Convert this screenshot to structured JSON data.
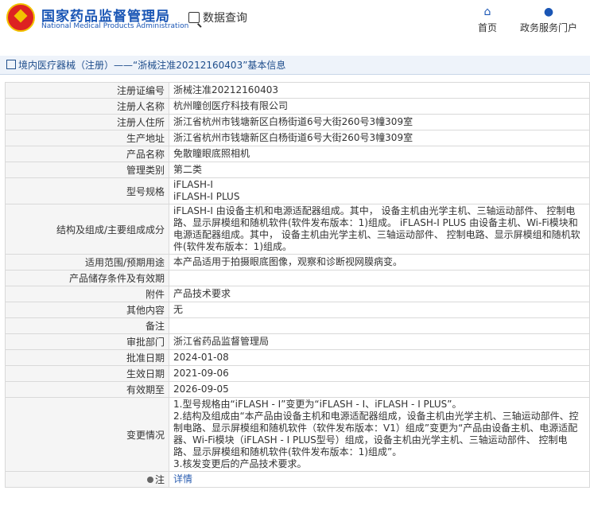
{
  "header": {
    "brand_cn": "国家药品监督管理局",
    "brand_en": "National Medical Products Administration",
    "search_label": "数据查询",
    "nav": {
      "home": "首页",
      "services": "政务服务门户"
    }
  },
  "breadcrumb": "境内医疗器械（注册）——“浙械注准20212160403”基本信息",
  "rows": [
    {
      "k": "注册证编号",
      "v": [
        "浙械注准20212160403"
      ]
    },
    {
      "k": "注册人名称",
      "v": [
        "杭州瞳创医疗科技有限公司"
      ]
    },
    {
      "k": "注册人住所",
      "v": [
        "浙江省杭州市钱塘新区白杨街道6号大街260号3幢309室"
      ]
    },
    {
      "k": "生产地址",
      "v": [
        "浙江省杭州市钱塘新区白杨街道6号大街260号3幢309室"
      ]
    },
    {
      "k": "产品名称",
      "v": [
        "免散瞳眼底照相机"
      ]
    },
    {
      "k": "管理类别",
      "v": [
        "第二类"
      ]
    },
    {
      "k": "型号规格",
      "v": [
        "iFLASH-I",
        "iFLASH-I PLUS"
      ]
    },
    {
      "k": "结构及组成/主要组成成分",
      "v": [
        "iFLASH-I 由设备主机和电源适配器组成。其中， 设备主机由光学主机、三轴运动部件、 控制电路、显示屏模组和随机软件(软件发布版本：1)组成。 iFLASH-I PLUS 由设备主机、Wi-Fi模块和电源适配器组成。其中， 设备主机由光学主机、三轴运动部件、 控制电路、显示屏模组和随机软件(软件发布版本：1)组成。"
      ]
    },
    {
      "k": "适用范围/预期用途",
      "v": [
        "本产品适用于拍摄眼底图像，观察和诊断视网膜病变。"
      ]
    },
    {
      "k": "产品储存条件及有效期",
      "v": [
        ""
      ]
    },
    {
      "k": "附件",
      "v": [
        "产品技术要求"
      ]
    },
    {
      "k": "其他内容",
      "v": [
        "无"
      ]
    },
    {
      "k": "备注",
      "v": [
        ""
      ]
    },
    {
      "k": "审批部门",
      "v": [
        "浙江省药品监督管理局"
      ]
    },
    {
      "k": "批准日期",
      "v": [
        "2024-01-08"
      ]
    },
    {
      "k": "生效日期",
      "v": [
        "2021-09-06"
      ]
    },
    {
      "k": "有效期至",
      "v": [
        "2026-09-05"
      ]
    },
    {
      "k": "变更情况",
      "v": [
        "1.型号规格由“iFLASH - I”变更为“iFLASH - I、iFLASH - I PLUS”。",
        "2.结构及组成由“本产品由设备主机和电源适配器组成，设备主机由光学主机、三轴运动部件、控制电路、显示屏模组和随机软件（软件发布版本：V1）组成”变更为“产品由设备主机、电源适配器、Wi-Fi模块（iFLASH - I PLUS型号）组成，设备主机由光学主机、三轴运动部件、 控制电路、显示屏模组和随机软件(软件发布版本：1)组成”。",
        "3.核发变更后的产品技术要求。"
      ]
    }
  ],
  "note": {
    "k": "注",
    "link": "详情"
  }
}
